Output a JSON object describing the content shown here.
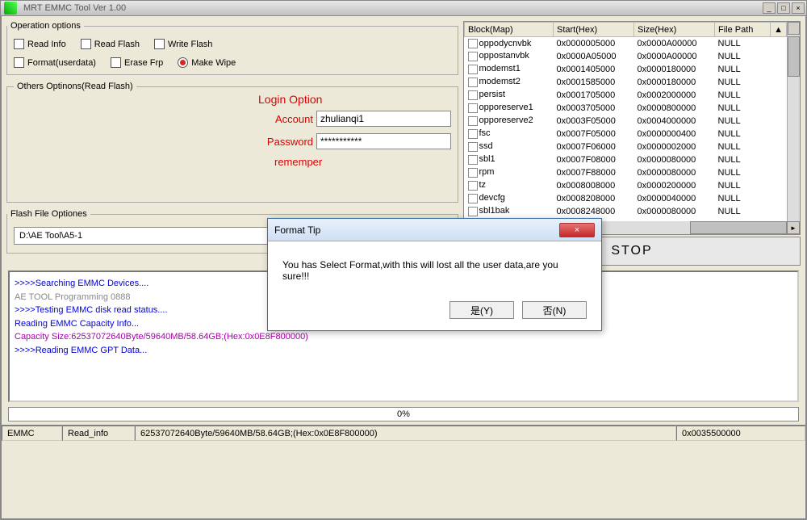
{
  "window": {
    "title": "MRT EMMC Tool Ver 1.00"
  },
  "op": {
    "legend": "Operation options",
    "read_info": "Read Info",
    "read_flash": "Read Flash",
    "write_flash": "Write Flash",
    "format": "Format(userdata)",
    "erase_frp": "Erase Frp",
    "make_wipe": "Make Wipe"
  },
  "others": {
    "legend": "Others Optinons(Read Flash)"
  },
  "login": {
    "title": "Login Option",
    "account_label": "Account",
    "account_value": "zhulianqi1",
    "password_label": "Password",
    "password_value": "***********",
    "remember": "rememper"
  },
  "flashfile": {
    "legend": "Flash File Optiones",
    "path": "D:\\AE Tool\\A5-1"
  },
  "stop": "STOP",
  "table": {
    "h_block": "Block(Map)",
    "h_start": "Start(Hex)",
    "h_size": "Size(Hex)",
    "h_path": "File Path",
    "rows": [
      {
        "b": "oppodycnvbk",
        "s": "0x0000005000",
        "z": "0x0000A00000",
        "p": "NULL"
      },
      {
        "b": "oppostanvbk",
        "s": "0x0000A05000",
        "z": "0x0000A00000",
        "p": "NULL"
      },
      {
        "b": "modemst1",
        "s": "0x0001405000",
        "z": "0x0000180000",
        "p": "NULL"
      },
      {
        "b": "modemst2",
        "s": "0x0001585000",
        "z": "0x0000180000",
        "p": "NULL"
      },
      {
        "b": "persist",
        "s": "0x0001705000",
        "z": "0x0002000000",
        "p": "NULL"
      },
      {
        "b": "opporeserve1",
        "s": "0x0003705000",
        "z": "0x0000800000",
        "p": "NULL"
      },
      {
        "b": "opporeserve2",
        "s": "0x0003F05000",
        "z": "0x0004000000",
        "p": "NULL"
      },
      {
        "b": "fsc",
        "s": "0x0007F05000",
        "z": "0x0000000400",
        "p": "NULL"
      },
      {
        "b": "ssd",
        "s": "0x0007F06000",
        "z": "0x0000002000",
        "p": "NULL"
      },
      {
        "b": "sbl1",
        "s": "0x0007F08000",
        "z": "0x0000080000",
        "p": "NULL"
      },
      {
        "b": "rpm",
        "s": "0x0007F88000",
        "z": "0x0000080000",
        "p": "NULL"
      },
      {
        "b": "tz",
        "s": "0x0008008000",
        "z": "0x0000200000",
        "p": "NULL"
      },
      {
        "b": "devcfg",
        "s": "0x0008208000",
        "z": "0x0000040000",
        "p": "NULL"
      },
      {
        "b": "sbl1bak",
        "s": "0x0008248000",
        "z": "0x0000080000",
        "p": "NULL"
      }
    ]
  },
  "log": {
    "l1": ">>>>Searching EMMC Devices....",
    "l2": "   AE  TOOL Programming    0888",
    "l3": ">>>>Testing EMMC disk read status....",
    "l4": "   Reading EMMC Capacity Info...",
    "l5": "   Capacity Size:62537072640Byte/59640MB/58.64GB;(Hex:0x0E8F800000)",
    "l6": ">>>>Reading EMMC GPT Data..."
  },
  "progress": "0%",
  "status": {
    "s1": "EMMC",
    "s2": "Read_info",
    "s3": "62537072640Byte/59640MB/58.64GB;(Hex:0x0E8F800000)",
    "s4": "0x0035500000"
  },
  "dialog": {
    "title": "Format Tip",
    "msg": "You has Select Format,with this will lost all the user data,are you sure!!!",
    "yes": "是(Y)",
    "no": "否(N)",
    "close": "×"
  }
}
